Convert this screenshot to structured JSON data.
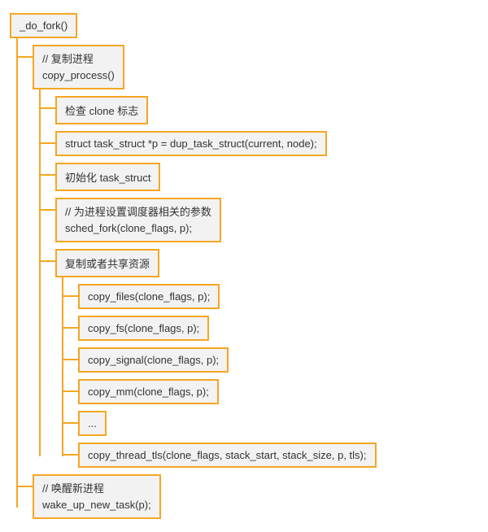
{
  "root": {
    "label": "_do_fork()"
  },
  "copy_process": {
    "comment": "// 复制进程",
    "call": "copy_process()"
  },
  "steps": {
    "check_clone": "检查 clone 标志",
    "dup_task": "struct task_struct *p = dup_task_struct(current, node);",
    "init_task": "初始化 task_struct",
    "sched_fork_comment": "// 为进程设置调度器相关的参数",
    "sched_fork_call": "sched_fork(clone_flags, p);",
    "share_resources": "复制或者共享资源"
  },
  "copies": {
    "files": "copy_files(clone_flags, p);",
    "fs": "copy_fs(clone_flags, p);",
    "signal": "copy_signal(clone_flags, p);",
    "mm": "copy_mm(clone_flags, p);",
    "ellipsis": "...",
    "thread_tls": "copy_thread_tls(clone_flags, stack_start, stack_size, p, tls);"
  },
  "wake_up": {
    "comment": "// 唤醒新进程",
    "call": "wake_up_new_task(p);"
  }
}
